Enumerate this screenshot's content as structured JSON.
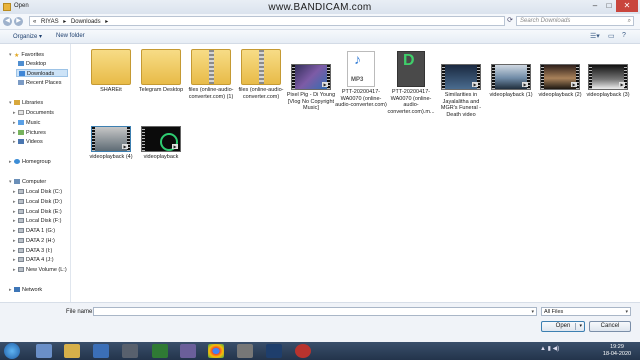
{
  "window": {
    "title": "Open",
    "overlay": "www.BANDICAM.com"
  },
  "address": {
    "path": [
      "RIYAS",
      "▸",
      "Downloads",
      "▸"
    ],
    "search_placeholder": "Search Downloads"
  },
  "toolbar": {
    "organize": "Organize ▾",
    "new_folder": "New folder"
  },
  "nav": {
    "favorites": "Favorites",
    "desktop": "Desktop",
    "downloads": "Downloads",
    "recent": "Recent Places",
    "libraries": "Libraries",
    "documents": "Documents",
    "music": "Music",
    "pictures": "Pictures",
    "videos": "Videos",
    "homegroup": "Homegroup",
    "computer": "Computer",
    "disks": [
      "Local Disk (C:)",
      "Local Disk (D:)",
      "Local Disk (E:)",
      "Local Disk (F:)",
      "DATA 1 (G:)",
      "DATA 2 (H:)",
      "DATA 3 (I:)",
      "DATA 4 (J:)",
      "New Volume (L:)"
    ],
    "network": "Network"
  },
  "files": [
    {
      "name": "SHAREit"
    },
    {
      "name": "Telegram Desktop"
    },
    {
      "name": "files (online-audio-converter.com) (1)"
    },
    {
      "name": "files (online-audio-converter.com)"
    },
    {
      "name": "Pixel Pig - Di Young [Vlog No Copyright Music]"
    },
    {
      "name": "PTT-20200417-WA0070 (online-audio-converter.com)",
      "badge": "MP3"
    },
    {
      "name": "PTT-20200417-WA0070 (online-audio-converter.com).m..."
    },
    {
      "name": "Similarities in Jayalalitha and MGR's Funeral - Death video"
    },
    {
      "name": "videoplayback (1)"
    },
    {
      "name": "videoplayback (2)"
    },
    {
      "name": "videoplayback (3)"
    },
    {
      "name": "videoplayback (4)"
    },
    {
      "name": "videoplayback"
    }
  ],
  "footer": {
    "file_name_label": "File name:",
    "filter": "All Files",
    "open": "Open",
    "cancel": "Cancel"
  },
  "taskbar": {
    "time": "19:29",
    "date": "18-04-2020"
  }
}
